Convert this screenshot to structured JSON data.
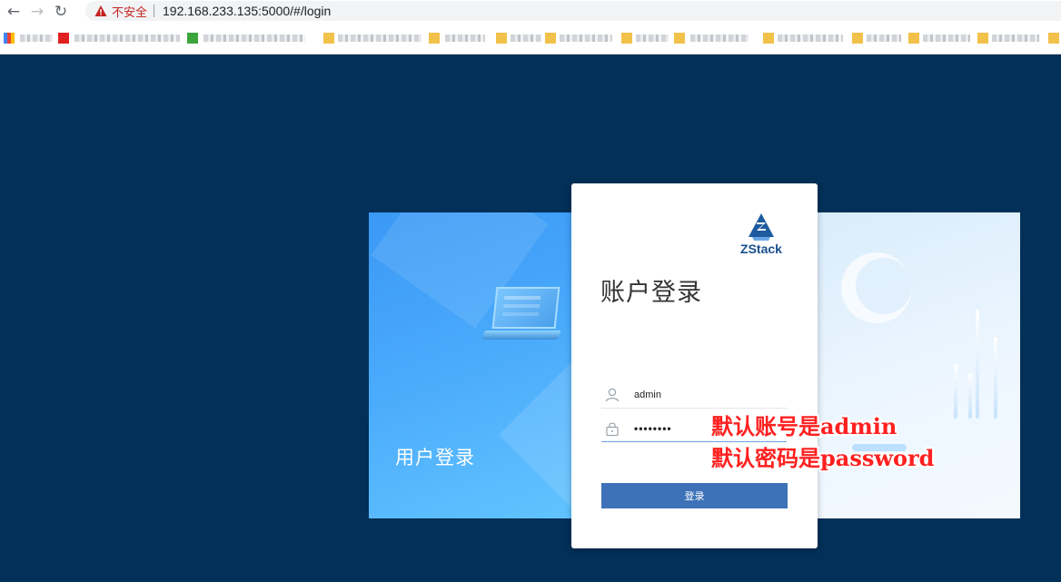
{
  "browser": {
    "nav": {
      "back_icon": "back-arrow-icon",
      "forward_icon": "forward-arrow-icon",
      "reload_icon": "reload-icon"
    },
    "address": {
      "security_label": "不安全",
      "url": "192.168.233.135:5000/#/login"
    }
  },
  "login": {
    "left_panel_title": "用户登录",
    "logo_text": "ZStack",
    "title": "账户登录",
    "username_value": "admin",
    "password_value": "••••••••",
    "submit_label": "登录",
    "colors": {
      "page_bg": "#023058",
      "button": "#3d72b8",
      "left_panel": "#49a9fb"
    }
  },
  "annotation": {
    "line1": "默认账号是admin",
    "line2": "默认密码是password",
    "color": "#ff2020"
  }
}
